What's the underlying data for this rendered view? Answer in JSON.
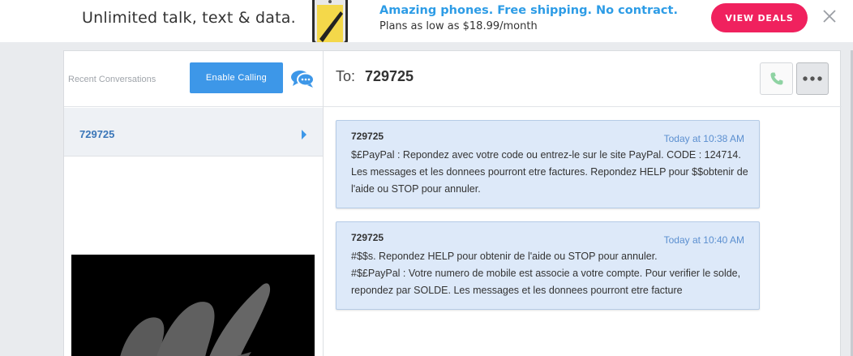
{
  "banner": {
    "tagline": "Unlimited talk, text & data.",
    "promo_title": "Amazing phones. Free shipping. No contract.",
    "promo_sub": "Plans as low as $18.99/month",
    "cta": "VIEW DEALS",
    "cta_color": "#f0215e",
    "promo_color": "#2d9ce6"
  },
  "sidebar": {
    "recent_label": "Recent Conversations",
    "enable_calling": "Enable Calling",
    "chat_icon": "chat-bubbles-icon",
    "conversations": [
      {
        "name": "729725"
      }
    ]
  },
  "conversation": {
    "to_label": "To:",
    "to_value": "729725",
    "call_icon": "phone-icon",
    "more_icon": "more-dots-icon",
    "messages": [
      {
        "sender": "729725",
        "time": "Today at 10:38 AM",
        "text": "$£PayPal : Repondez avec votre code ou entrez-le sur le site PayPal. CODE : 124714. Les messages et les donnees pourront etre factures. Repondez HELP pour $$obtenir de l'aide ou STOP pour annuler."
      },
      {
        "sender": "729725",
        "time": "Today at 10:40 AM",
        "text": "#$$s. Repondez HELP pour obtenir de l'aide ou STOP pour annuler.\n#$£PayPal : Votre numero de mobile est associe a votre compte. Pour verifier le solde, repondez par SOLDE. Les messages et les donnees pourront etre facture"
      }
    ]
  }
}
